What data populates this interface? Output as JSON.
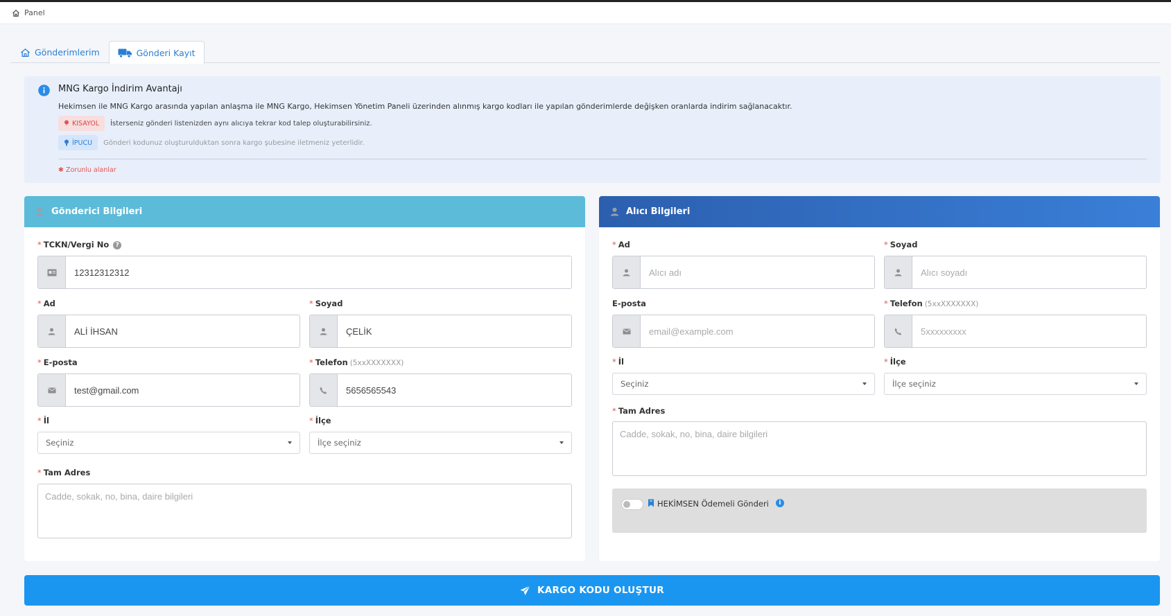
{
  "breadcrumb": {
    "label": "Panel"
  },
  "tabs": [
    {
      "label": "Gönderimlerim",
      "active": false
    },
    {
      "label": "Gönderi Kayıt",
      "active": true
    }
  ],
  "info": {
    "title": "MNG Kargo İndirim Avantajı",
    "description": "Hekimsen ile MNG Kargo arasında yapılan anlaşma ile MNG Kargo, Hekimsen Yönetim Paneli üzerinden alınmış kargo kodları ile yapılan gönderimlerde değişken oranlarda indirim sağlanacaktır.",
    "shortcut_tag": "KISAYOL",
    "shortcut_text": "İsterseniz gönderi listenizden aynı alıcıya tekrar kod talep oluşturabilirsiniz.",
    "tip_tag": "İPUCU",
    "tip_text": "Gönderi kodunuz oluşturulduktan sonra kargo şubesine iletmeniz yeterlidir.",
    "required_note": "Zorunlu alanlar"
  },
  "sender": {
    "title": "Gönderici Bilgileri",
    "tckn_label": "TCKN/Vergi No",
    "tckn_value": "12312312312",
    "name_label": "Ad",
    "name_value": "ALİ İHSAN",
    "surname_label": "Soyad",
    "surname_value": "ÇELİK",
    "email_label": "E-posta",
    "email_value": "test@gmail.com",
    "phone_label": "Telefon",
    "phone_hint": "(5xxXXXXXXX)",
    "phone_value": "5656565543",
    "city_label": "İl",
    "city_value": "Seçiniz",
    "district_label": "İlçe",
    "district_value": "İlçe seçiniz",
    "address_label": "Tam Adres",
    "address_placeholder": "Cadde, sokak, no, bina, daire bilgileri"
  },
  "receiver": {
    "title": "Alıcı Bilgileri",
    "name_label": "Ad",
    "name_placeholder": "Alıcı adı",
    "surname_label": "Soyad",
    "surname_placeholder": "Alıcı soyadı",
    "email_label": "E-posta",
    "email_placeholder": "email@example.com",
    "phone_label": "Telefon",
    "phone_hint": "(5xxXXXXXXX)",
    "phone_placeholder": "5xxxxxxxxx",
    "city_label": "İl",
    "city_value": "Seçiniz",
    "district_label": "İlçe",
    "district_value": "İlçe seçiniz",
    "address_label": "Tam Adres",
    "address_placeholder": "Cadde, sokak, no, bina, daire bilgileri",
    "payment_label": "HEKİMSEN Ödemeli Gönderi",
    "payment_enabled": false
  },
  "submit": {
    "label": "KARGO KODU OLUŞTUR"
  },
  "colors": {
    "accent": "#1a96f0",
    "sender_header": "#5bbbd9",
    "receiver_header": "#2c5fae",
    "required": "#e05555"
  }
}
